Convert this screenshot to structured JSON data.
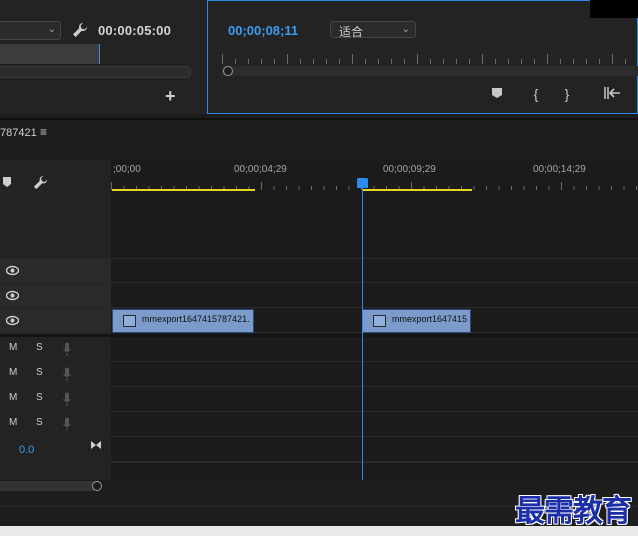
{
  "source_monitor": {
    "timecode": "00:00:05:00",
    "icons": {
      "wrench": "wrench-icon",
      "add": "plus-icon"
    },
    "add_label": "+"
  },
  "program_monitor": {
    "timecode": "00;00;08;11",
    "fit_label": "适合",
    "buttons": [
      {
        "name": "add-marker-button",
        "glyph": "⬟"
      },
      {
        "name": "mark-in-button",
        "glyph": "{"
      },
      {
        "name": "mark-out-button",
        "glyph": "}"
      },
      {
        "name": "go-to-in-button",
        "glyph": "{←"
      }
    ]
  },
  "timeline": {
    "sequence_name": "787421",
    "menu_glyph": "≡",
    "ruler_labels": [
      ";00;00",
      "00;00;04;29",
      "00;00;09;29",
      "00;00;14;29"
    ],
    "clips": [
      {
        "name": "mmexport1647415787421."
      },
      {
        "name": "mmexport1647415"
      }
    ],
    "audio_tracks": [
      {
        "mute": "M",
        "solo": "S"
      },
      {
        "mute": "M",
        "solo": "S"
      },
      {
        "mute": "M",
        "solo": "S"
      },
      {
        "mute": "M",
        "solo": "S"
      }
    ],
    "master_value": "0.0",
    "colors": {
      "accent": "#2d8ceb",
      "work_area": "#e8d51e",
      "clip": "#7b9ccb"
    }
  },
  "watermark": "最需教育"
}
